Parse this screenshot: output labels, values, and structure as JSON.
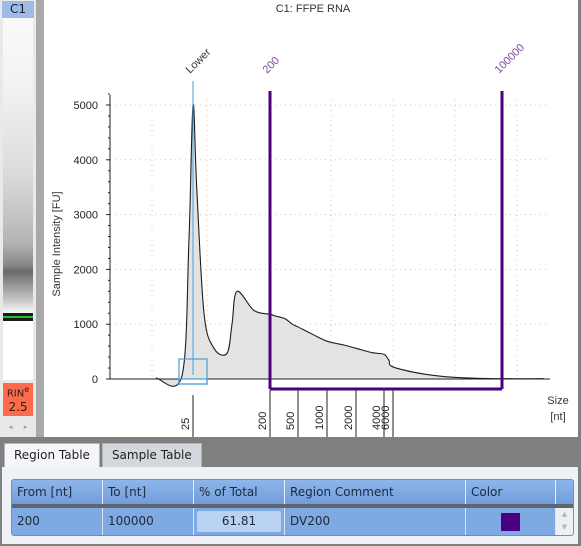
{
  "gel": {
    "lane_label": "C1",
    "rin_label": "RIN",
    "rin_superscript": "e",
    "rin_value": "2.5",
    "scroll_left": "◂",
    "scroll_right": "▸"
  },
  "chart_data": {
    "type": "line",
    "title": "C1: FFPE RNA",
    "xlabel": "Size [nt]",
    "xlabel_line1": "Size",
    "xlabel_line2": "[nt]",
    "ylabel": "Sample Intensity [FU]",
    "ylim": [
      0,
      5000
    ],
    "y_ticks": [
      0,
      1000,
      2000,
      3000,
      4000,
      5000
    ],
    "x_scale": "categorical-ladder",
    "x_ticks": [
      "25",
      "200",
      "500",
      "1000",
      "2000",
      "4000",
      "6000"
    ],
    "markers": [
      {
        "label": "Lower",
        "x": "25",
        "color": "#4a9fd8"
      },
      {
        "label": "200",
        "x": "200",
        "color": "#7b4ca0"
      },
      {
        "label": "100000",
        "x": "100000",
        "color": "#7b4ca0"
      }
    ],
    "region": {
      "from": 200,
      "to": 100000,
      "color": "#4b0082"
    },
    "series": [
      {
        "name": "C1 electropherogram",
        "x": [
          "~15",
          "20",
          "23",
          "25",
          "28",
          "35",
          "50",
          "80",
          "110",
          "140",
          "170",
          "200",
          "230",
          "300",
          "400",
          "500",
          "700",
          "1000",
          "1500",
          "2000",
          "3000",
          "4000",
          "5000",
          "6000",
          "10000",
          "20000",
          "60000",
          "100000",
          "200000"
        ],
        "values": [
          20,
          60,
          2500,
          5000,
          3500,
          1200,
          560,
          470,
          1000,
          1600,
          1250,
          1180,
          1150,
          1100,
          1000,
          950,
          820,
          690,
          620,
          560,
          480,
          450,
          340,
          220,
          90,
          30,
          10,
          5,
          5
        ]
      }
    ]
  },
  "tabs": [
    {
      "label": "Region Table",
      "active": true
    },
    {
      "label": "Sample Table",
      "active": false
    }
  ],
  "region_table": {
    "columns": [
      "From [nt]",
      "To [nt]",
      "% of Total",
      "Region Comment",
      "Color"
    ],
    "rows": [
      {
        "from": "200",
        "to": "100000",
        "pct_total": "61.81",
        "comment": "DV200",
        "color": "#4b0082"
      }
    ],
    "scroll_up": "▲",
    "scroll_down": "▼"
  }
}
